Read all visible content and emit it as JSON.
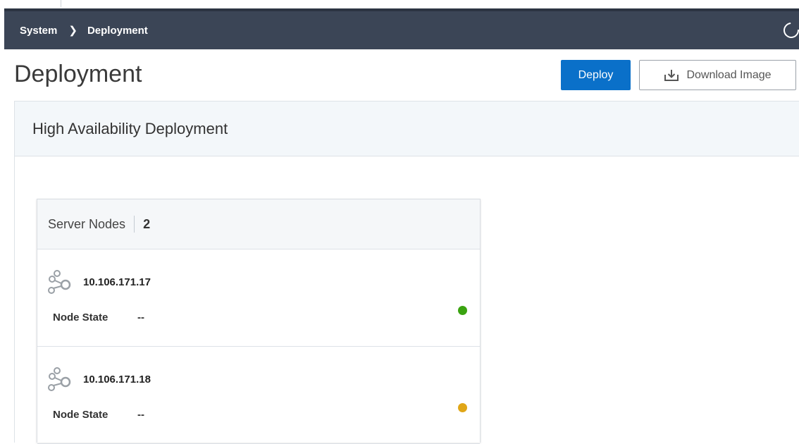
{
  "breadcrumb": {
    "items": [
      "System",
      "Deployment"
    ],
    "separator": "❯"
  },
  "page": {
    "title": "Deployment"
  },
  "actions": {
    "deploy_label": "Deploy",
    "download_label": "Download Image"
  },
  "panel": {
    "title": "High Availability Deployment"
  },
  "server_nodes": {
    "label": "Server Nodes",
    "count": "2",
    "nodes": [
      {
        "ip": "10.106.171.17",
        "state_label": "Node State",
        "state_value": "--",
        "status_color": "#3aa310"
      },
      {
        "ip": "10.106.171.18",
        "state_label": "Node State",
        "state_value": "--",
        "status_color": "#e0a617"
      }
    ]
  },
  "colors": {
    "navbar": "#3b4556",
    "primary": "#0a70c9"
  }
}
